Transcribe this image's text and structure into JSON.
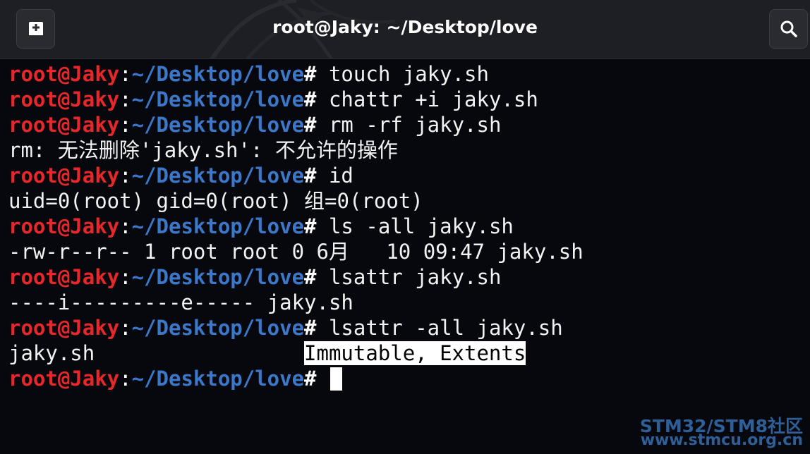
{
  "window": {
    "title": "root@Jaky: ~/Desktop/love"
  },
  "icons": {
    "new_tab": "new-tab-icon",
    "search": "search-icon"
  },
  "prompt": {
    "user": "root@Jaky",
    "colon": ":",
    "path": "~/Desktop/love",
    "hash": "#"
  },
  "colors": {
    "user": "#e8272a",
    "path": "#3b78c9",
    "background": "#06080d",
    "text": "#f2f2f2"
  },
  "terminal": {
    "lines": [
      {
        "type": "prompt",
        "command": " touch jaky.sh"
      },
      {
        "type": "prompt",
        "command": " chattr +i jaky.sh"
      },
      {
        "type": "prompt",
        "command": " rm -rf jaky.sh"
      },
      {
        "type": "output",
        "text": "rm: 无法删除'jaky.sh': 不允许的操作"
      },
      {
        "type": "prompt",
        "command": " id"
      },
      {
        "type": "output",
        "text": "uid=0(root) gid=0(root) 组=0(root)"
      },
      {
        "type": "prompt",
        "command": " ls -all jaky.sh"
      },
      {
        "type": "output",
        "text": "-rw-r--r-- 1 root root 0 6月   10 09:47 jaky.sh"
      },
      {
        "type": "prompt",
        "command": " lsattr jaky.sh"
      },
      {
        "type": "output",
        "text": "----i---------e----- jaky.sh"
      },
      {
        "type": "prompt",
        "command": " lsattr -all jaky.sh"
      },
      {
        "type": "attr",
        "file": "jaky.sh",
        "gap": "                 ",
        "attrs": "Immutable, Extents"
      },
      {
        "type": "prompt",
        "command": " "
      }
    ]
  },
  "watermark": {
    "line1": "STM32/STM8社区",
    "line2": "www.stmcu.org.cn"
  }
}
